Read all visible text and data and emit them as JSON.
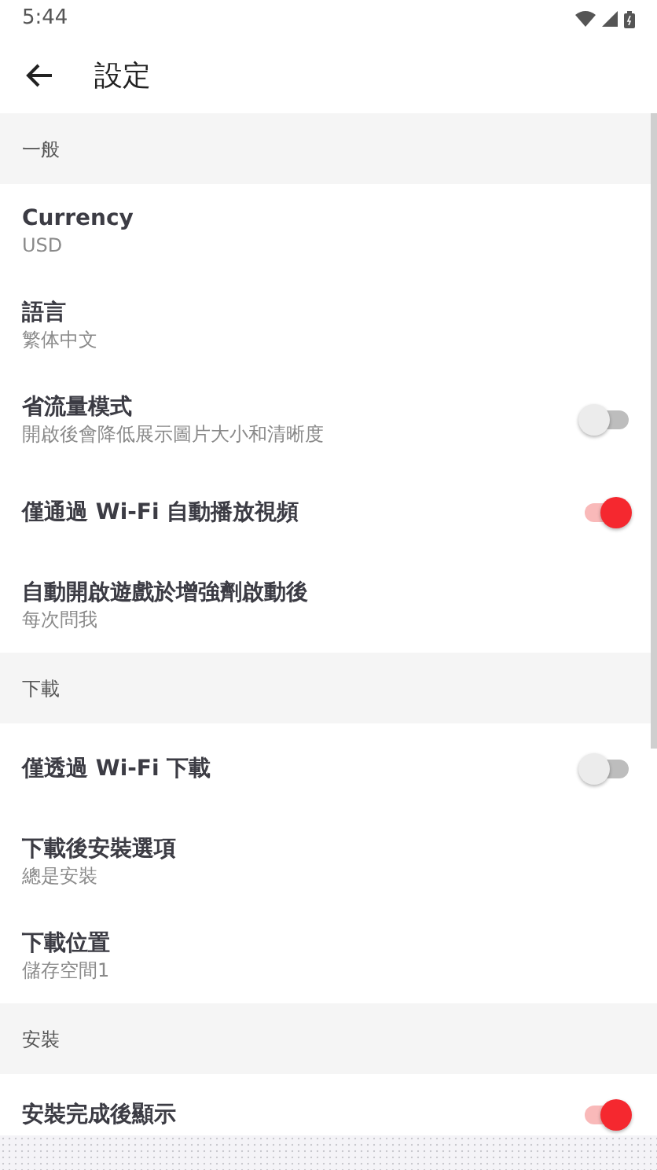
{
  "status_bar": {
    "time": "5:44"
  },
  "app_bar": {
    "title": "設定"
  },
  "sections": [
    {
      "header": "一般",
      "items": [
        {
          "kind": "value",
          "title": "Currency",
          "subtitle": "USD"
        },
        {
          "kind": "value",
          "title": "語言",
          "subtitle": "繁体中文"
        },
        {
          "kind": "switch",
          "title": "省流量模式",
          "subtitle": "開啟後會降低展示圖片大小和清晰度",
          "on": false
        },
        {
          "kind": "switch",
          "title": "僅通過 Wi-Fi 自動播放視頻",
          "on": true
        },
        {
          "kind": "value",
          "title": "自動開啟遊戲於增強劑啟動後",
          "subtitle": "每次問我"
        }
      ]
    },
    {
      "header": "下載",
      "items": [
        {
          "kind": "switch",
          "title": "僅透過 Wi-Fi 下載",
          "on": false
        },
        {
          "kind": "value",
          "title": "下載後安裝選項",
          "subtitle": "總是安裝"
        },
        {
          "kind": "value",
          "title": "下載位置",
          "subtitle": "儲存空間1"
        }
      ]
    },
    {
      "header": "安裝",
      "items": [
        {
          "kind": "switch",
          "title": "安裝完成後顯示",
          "on": true
        }
      ]
    }
  ]
}
